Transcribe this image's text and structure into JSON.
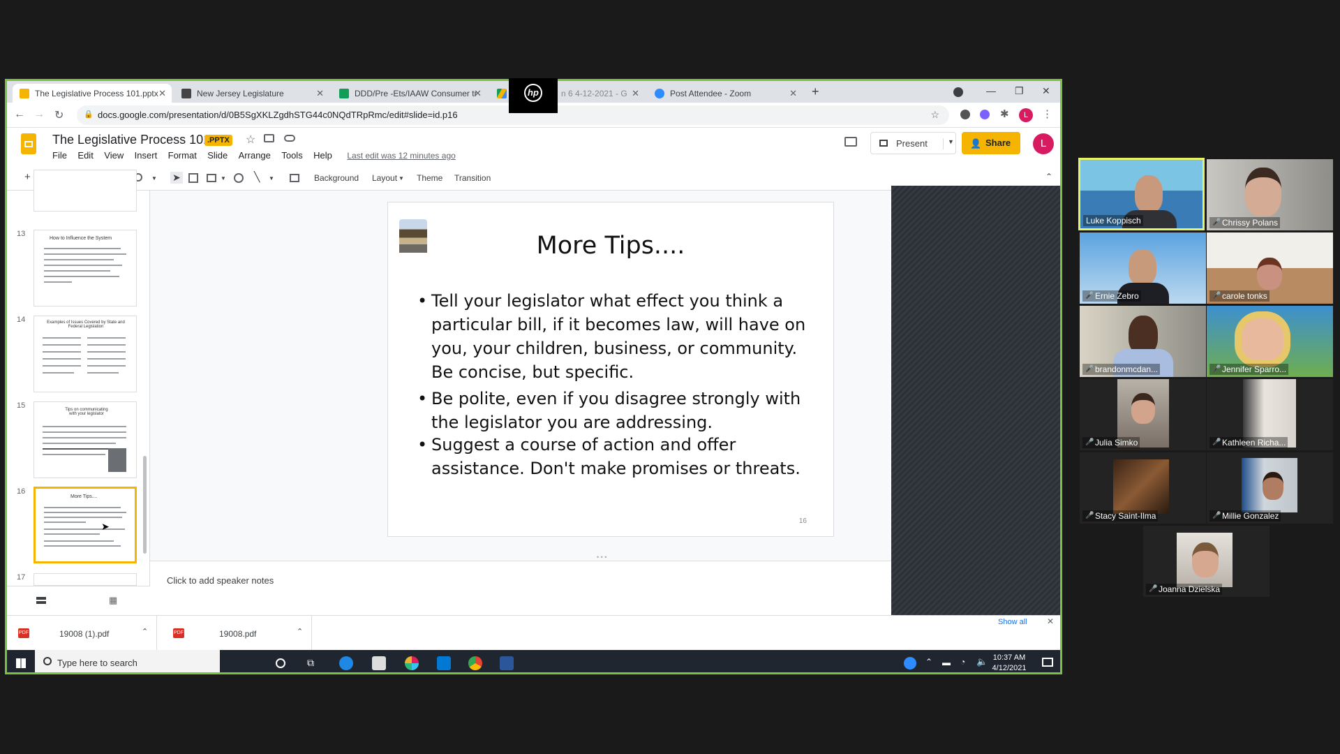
{
  "browser": {
    "tabs": [
      {
        "title": "The Legislative Process 101.pptx",
        "icon_color": "#f4b400",
        "active": true
      },
      {
        "title": "New Jersey Legislature",
        "icon_color": "#444444",
        "active": false
      },
      {
        "title": "DDD/Pre -Ets/IAAW Consumer tr",
        "icon_color": "#0f9d58",
        "active": false
      },
      {
        "title": "n 6 4-12-2021 - G",
        "icon_color": "#4285f4",
        "active": false
      },
      {
        "title": "Post Attendee - Zoom",
        "icon_color": "#2d8cff",
        "active": false
      }
    ],
    "new_tab": "+",
    "url": "docs.google.com/presentation/d/0B5SgXKLZgdhSTG44c0NQdTRpRmc/edit#slide=id.p16",
    "profile_initial": "L"
  },
  "app": {
    "doc_title": "The Legislative Process 101",
    "badge": ".PPTX",
    "menu": [
      "File",
      "Edit",
      "View",
      "Insert",
      "Format",
      "Slide",
      "Arrange",
      "Tools",
      "Help"
    ],
    "last_edit": "Last edit was 12 minutes ago",
    "present_label": "Present",
    "share_label": "Share",
    "avatar_initial": "L",
    "accent": "#f4b400"
  },
  "toolbar": {
    "background": "Background",
    "layout": "Layout",
    "theme": "Theme",
    "transition": "Transition"
  },
  "filmstrip": {
    "slides": [
      {
        "num": "13",
        "title": "How to Influence the System"
      },
      {
        "num": "14",
        "title": "Examples of Issues Covered by State and Federal Legislation"
      },
      {
        "num": "15",
        "title": "Tips on communicating with your legislator"
      },
      {
        "num": "16",
        "title": "More Tips...."
      },
      {
        "num": "17",
        "title": ""
      }
    ]
  },
  "slide": {
    "title": "More Tips....",
    "bullets": [
      "Tell your legislator what effect you think a particular bill, if it becomes law, will have on you, your children, business, or community. Be concise, but specific.",
      "Be polite, even if you disagree strongly with the legislator you are addressing.",
      "Suggest a course of action and offer assistance. Don't make promises or threats."
    ],
    "page_number": "16"
  },
  "notes_placeholder": "Click to add speaker notes",
  "downloads": {
    "files": [
      "19008 (1).pdf",
      "19008.pdf"
    ],
    "show_all": "Show all"
  },
  "taskbar": {
    "search_placeholder": "Type here to search",
    "time": "10:37 AM",
    "date": "4/12/2021"
  },
  "zoom": {
    "participants": [
      {
        "name": "Luke Koppisch",
        "active": true
      },
      {
        "name": "Chrissy Polans",
        "active": false
      },
      {
        "name": "Ernie Zebro",
        "active": false
      },
      {
        "name": "carole tonks",
        "active": false
      },
      {
        "name": "brandonmcdan...",
        "active": false
      },
      {
        "name": "Jennifer Sparro...",
        "active": false
      },
      {
        "name": "Julia Simko",
        "active": false
      },
      {
        "name": "Kathleen Richa...",
        "active": false
      },
      {
        "name": "Stacy Saint-Ilma",
        "active": false
      },
      {
        "name": "Millie Gonzalez",
        "active": false
      },
      {
        "name": "Joanna Dzielska",
        "active": false
      }
    ]
  }
}
